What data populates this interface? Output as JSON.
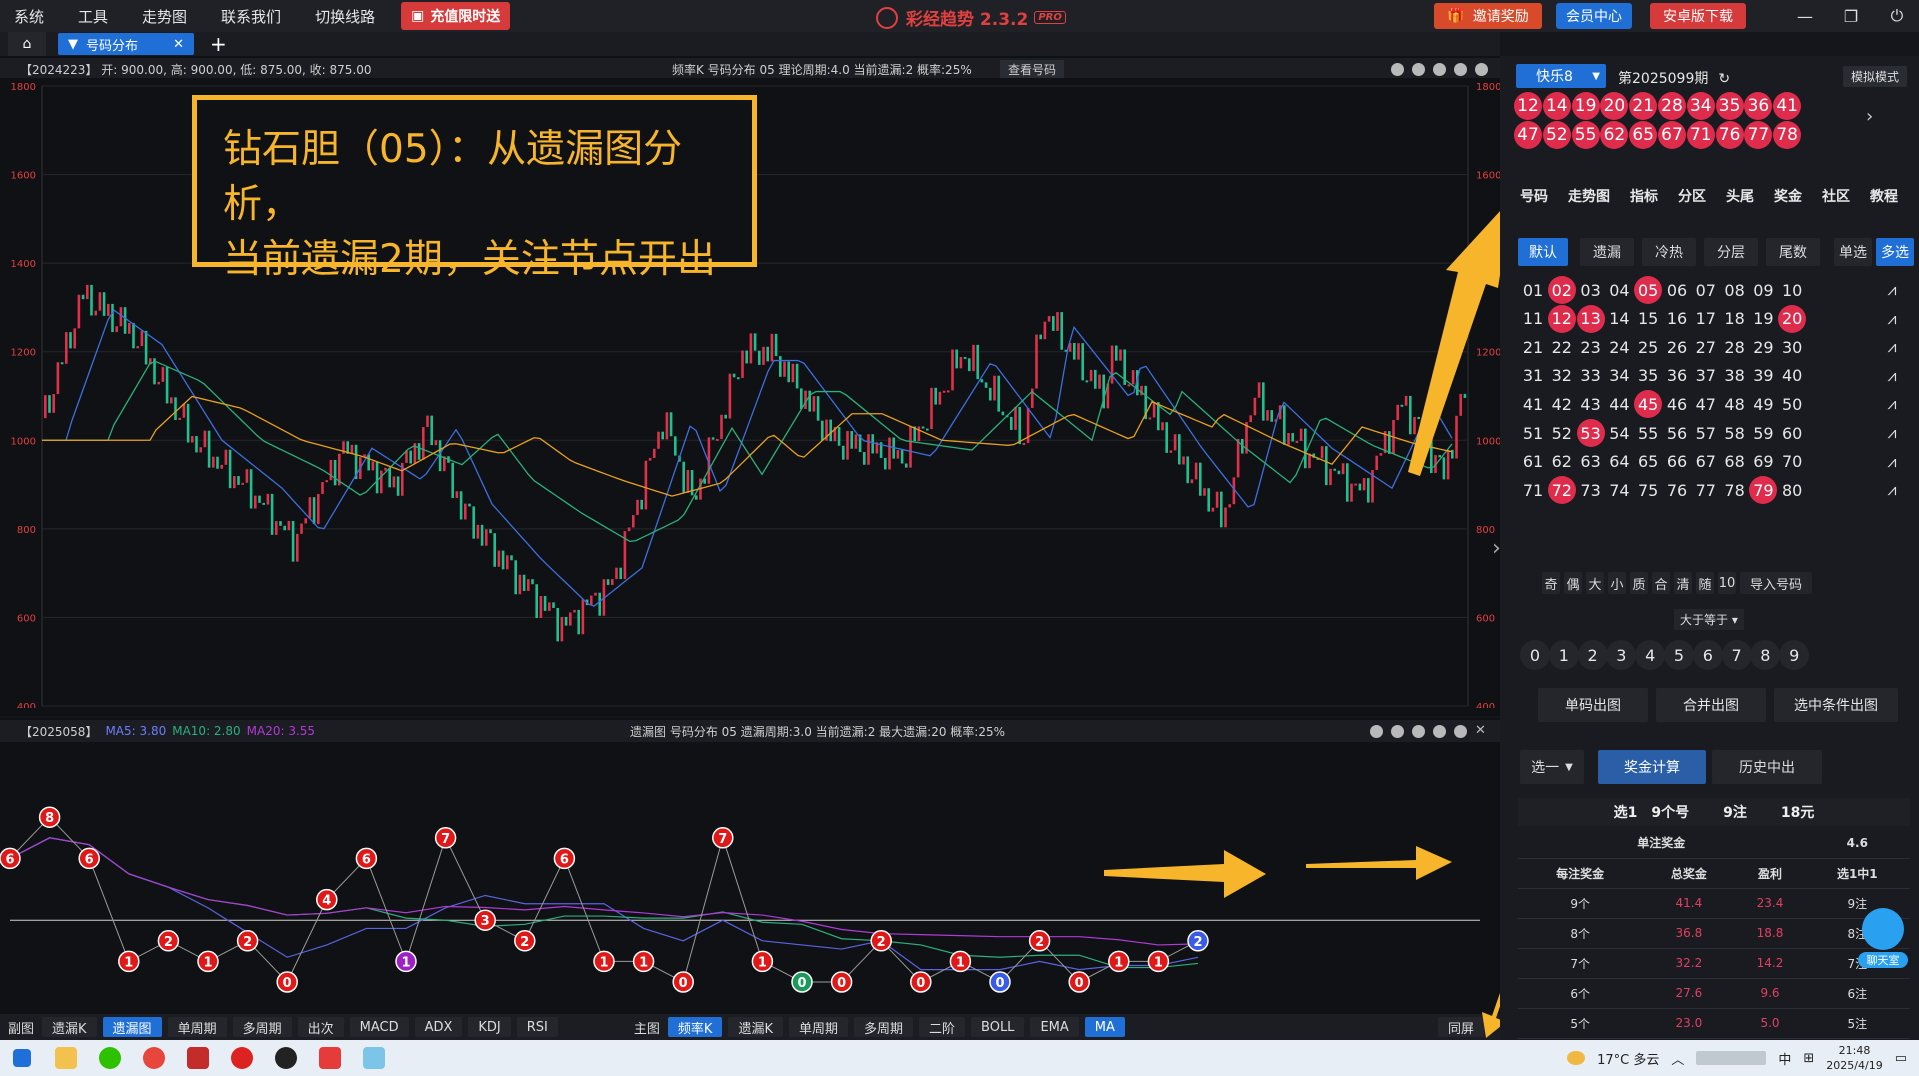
{
  "menu": {
    "items": [
      "系统",
      "工具",
      "走势图",
      "联系我们",
      "切换线路"
    ],
    "promo": "充值限时送"
  },
  "app": {
    "title": "彩经趋势 2.3.2",
    "badge": "PRO"
  },
  "top_buttons": {
    "invite": "邀请奖励",
    "member": "会员中心",
    "android": "安卓版下载"
  },
  "tabs": {
    "active": "号码分布",
    "add": "+"
  },
  "upper": {
    "left": "【2024223】  开: 900.00, 高: 900.00, 低: 875.00, 收: 875.00",
    "center": "频率K   号码分布   05      理论周期:4.0   当前遗漏:2   概率:25%",
    "view_btn": "查看号码",
    "y_ticks": [
      "1800",
      "1600",
      "1400",
      "1200",
      "1000",
      "800",
      "600",
      "400"
    ]
  },
  "annotation": {
    "line1": "钻石胆（05）：从遗漏图分析，",
    "line2": "当前遗漏2期，关注节点开出"
  },
  "lower": {
    "left": "【2025058】",
    "ma5": "MA5: 3.80",
    "ma10": "MA10: 2.80",
    "ma20": "MA20: 3.55",
    "center": "遗漏图   号码分布   05      遗漏周期:3.0   当前遗漏:2   最大遗漏:20   概率:25%",
    "miss_values": [
      6,
      8,
      6,
      1,
      2,
      1,
      2,
      0,
      4,
      6,
      1,
      7,
      3,
      2,
      6,
      1,
      1,
      0,
      7,
      1,
      0,
      0,
      2,
      0,
      1,
      0,
      2,
      0,
      1,
      1,
      2
    ]
  },
  "bottom_left": {
    "label": "副图",
    "buttons": [
      "遗漏K",
      "遗漏图",
      "单周期",
      "多周期",
      "出次",
      "MACD",
      "ADX",
      "KDJ",
      "RSI"
    ],
    "active": "遗漏图"
  },
  "bottom_main": {
    "label": "主图",
    "buttons": [
      "频率K",
      "遗漏K",
      "单周期",
      "多周期",
      "二阶",
      "BOLL",
      "EMA",
      "MA"
    ],
    "active": [
      "频率K",
      "MA"
    ]
  },
  "bottom_sync": "同屏",
  "right": {
    "lottery": "快乐8",
    "period": "第2025099期",
    "mock": "模拟模式",
    "draw": [
      "12",
      "14",
      "19",
      "20",
      "21",
      "28",
      "34",
      "35",
      "36",
      "41",
      "47",
      "52",
      "55",
      "62",
      "65",
      "67",
      "71",
      "76",
      "77",
      "78"
    ],
    "nav": [
      "号码",
      "走势图",
      "指标",
      "分区",
      "头尾",
      "奖金",
      "社区",
      "教程"
    ],
    "filters": [
      "默认",
      "遗漏",
      "冷热",
      "分层",
      "尾数"
    ],
    "mode": {
      "single": "单选",
      "multi": "多选"
    },
    "selected": [
      "02",
      "05",
      "12",
      "13",
      "20",
      "45",
      "53",
      "72",
      "79"
    ],
    "quick": [
      "奇",
      "偶",
      "大",
      "小",
      "质",
      "合",
      "清",
      "随",
      "10",
      "导入号码"
    ],
    "ge": "大于等于",
    "digits": [
      "0",
      "1",
      "2",
      "3",
      "4",
      "5",
      "6",
      "7",
      "8",
      "9"
    ],
    "actions": [
      "单码出图",
      "合并出图",
      "选中条件出图"
    ],
    "pick": "选一",
    "calc": "奖金计算",
    "history": "历史中出",
    "summary": {
      "sel": "选1",
      "cnt": "9个号",
      "bets": "9注",
      "cost": "18元"
    },
    "unit_label": "单注奖金",
    "unit_val": "4.6",
    "headers": [
      "每注奖金",
      "总奖金",
      "盈利",
      "选1中1"
    ],
    "rows": [
      [
        "9个",
        "41.4",
        "23.4",
        "9注"
      ],
      [
        "8个",
        "36.8",
        "18.8",
        "8注"
      ],
      [
        "7个",
        "32.2",
        "14.2",
        "7注"
      ],
      [
        "6个",
        "27.6",
        "9.6",
        "6注"
      ],
      [
        "5个",
        "23.0",
        "5.0",
        "5注"
      ]
    ],
    "chat": "聊天室"
  },
  "taskbar": {
    "weather": "17°C  多云",
    "time": "21:48",
    "date": "2025/4/19",
    "ime": "中"
  },
  "colors": {
    "accent": "#1f6fd6",
    "ball_red": "#e02c4c",
    "annotation": "#f7b52b",
    "up": "#e0304a",
    "down": "#1fbf8f"
  }
}
